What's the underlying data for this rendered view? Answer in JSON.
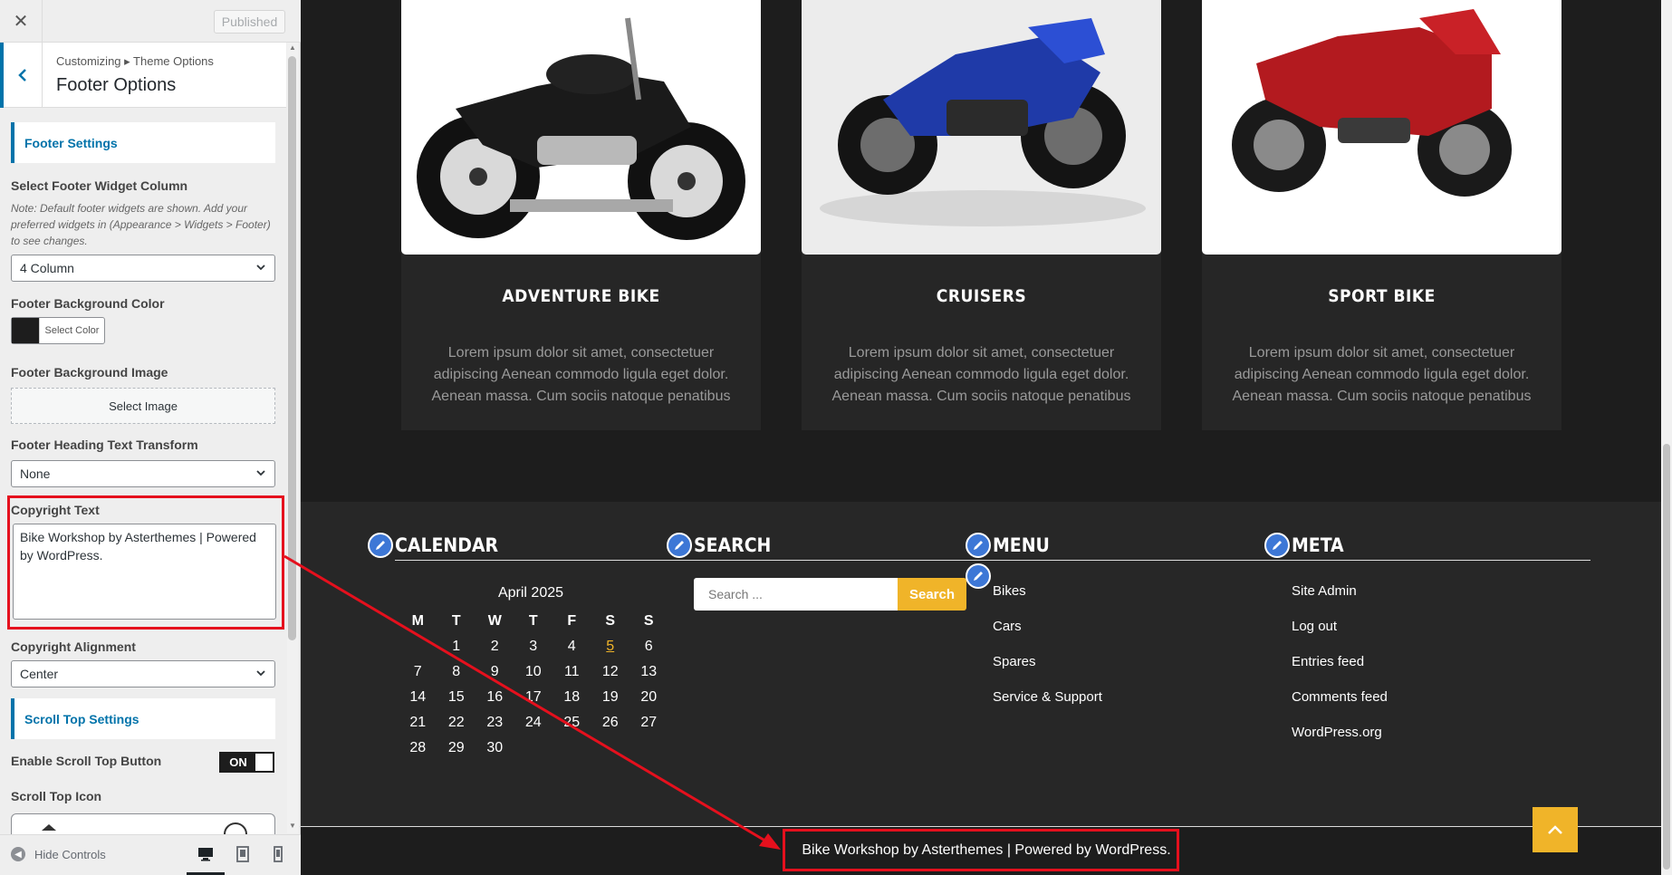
{
  "topbar": {
    "close_icon": "close-icon",
    "publish_label": "Published"
  },
  "section": {
    "breadcrumb": "Customizing ▸ Theme Options",
    "title": "Footer Options"
  },
  "controls": {
    "footer_settings_title": "Footer Settings",
    "widget_column_label": "Select Footer Widget Column",
    "widget_column_note": "Note: Default footer widgets are shown. Add your preferred widgets in (Appearance > Widgets > Footer) to see changes.",
    "widget_column_value": "4 Column",
    "bg_color_label": "Footer Background Color",
    "bg_color_value": "#1d1d1d",
    "select_color_label": "Select Color",
    "bg_image_label": "Footer Background Image",
    "select_image_label": "Select Image",
    "heading_transform_label": "Footer Heading Text Transform",
    "heading_transform_value": "None",
    "copyright_label": "Copyright Text",
    "copyright_value": "Bike Workshop by Asterthemes | Powered by WordPress.",
    "copyright_align_label": "Copyright Alignment",
    "copyright_align_value": "Center",
    "scroll_top_title": "Scroll Top Settings",
    "scroll_top_enable_label": "Enable Scroll Top Button",
    "scroll_top_toggle": "ON",
    "scroll_top_icon_label": "Scroll Top Icon"
  },
  "footer_bar": {
    "hide_controls": "Hide Controls"
  },
  "cards": [
    {
      "title": "ADVENTURE BIKE",
      "desc": "Lorem ipsum dolor sit amet, consectetuer adipiscing Aenean commodo ligula eget dolor. Aenean massa. Cum sociis natoque penatibus"
    },
    {
      "title": "CRUISERS",
      "desc": "Lorem ipsum dolor sit amet, consectetuer adipiscing Aenean commodo ligula eget dolor. Aenean massa. Cum sociis natoque penatibus"
    },
    {
      "title": "SPORT BIKE",
      "desc": "Lorem ipsum dolor sit amet, consectetuer adipiscing Aenean commodo ligula eget dolor. Aenean massa. Cum sociis natoque penatibus"
    }
  ],
  "widgets": {
    "calendar": {
      "title": "CALENDAR",
      "caption": "April 2025",
      "days": [
        "M",
        "T",
        "W",
        "T",
        "F",
        "S",
        "S"
      ],
      "weeks": [
        [
          "",
          "1",
          "2",
          "3",
          "4",
          "5",
          "6"
        ],
        [
          "7",
          "8",
          "9",
          "10",
          "11",
          "12",
          "13"
        ],
        [
          "14",
          "15",
          "16",
          "17",
          "18",
          "19",
          "20"
        ],
        [
          "21",
          "22",
          "23",
          "24",
          "25",
          "26",
          "27"
        ],
        [
          "28",
          "29",
          "30",
          "",
          "",
          "",
          ""
        ]
      ],
      "today": "5"
    },
    "search": {
      "title": "SEARCH",
      "placeholder": "Search ...",
      "button": "Search"
    },
    "menu": {
      "title": "MENU",
      "items": [
        "Bikes",
        "Cars",
        "Spares",
        "Service & Support"
      ]
    },
    "meta": {
      "title": "META",
      "items": [
        "Site Admin",
        "Log out",
        "Entries feed",
        "Comments feed",
        "WordPress.org"
      ]
    }
  },
  "copyright": {
    "text": "Bike Workshop by Asterthemes | Powered by WordPress."
  },
  "colors": {
    "accent": "#f0b429",
    "wp_blue": "#0073aa",
    "highlight_red": "#e5101d",
    "footer_bg": "#1d1d1d"
  }
}
